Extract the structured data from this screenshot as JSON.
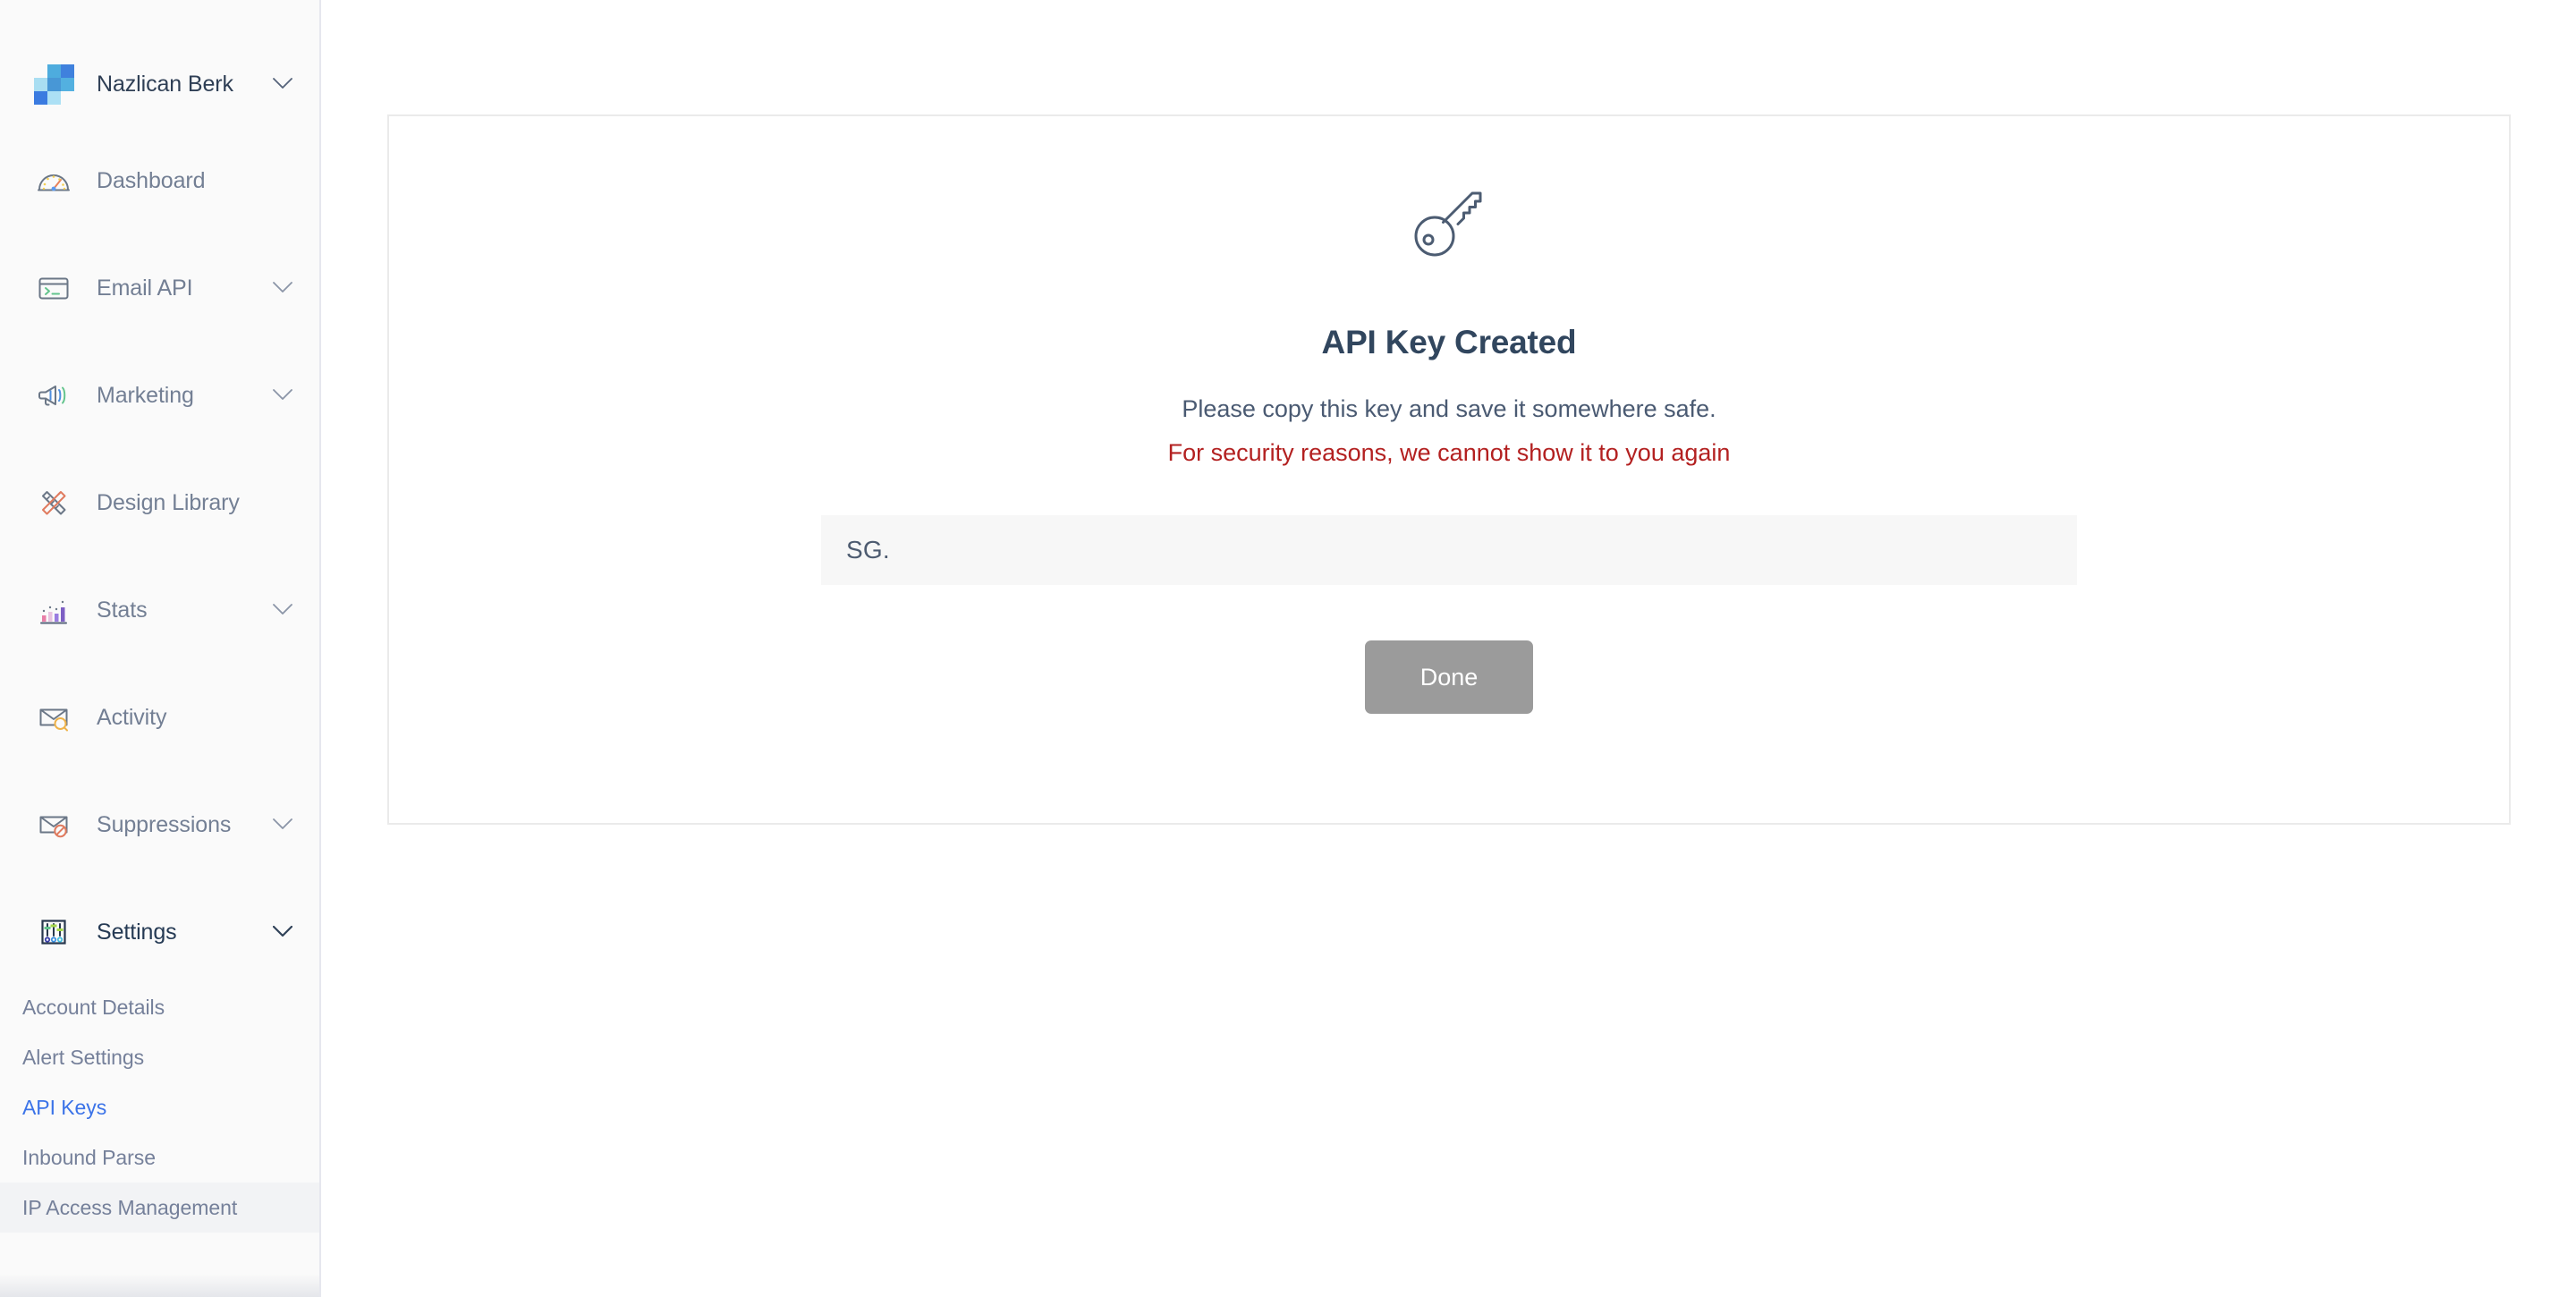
{
  "sidebar": {
    "account": {
      "name": "Nazlican Berk",
      "caret_icon": "chevron-down-icon",
      "logo_icon": "sendgrid-logo-icon",
      "logo_colors": [
        "#a9def2",
        "#4eacde",
        "#3f81dd",
        "#4897d6",
        "#53b0e0",
        "#3a7be0",
        "#ace0f5"
      ]
    },
    "items": [
      {
        "label": "Dashboard",
        "icon": "speedometer-icon",
        "has_caret": false,
        "active": false
      },
      {
        "label": "Email API",
        "icon": "terminal-card-icon",
        "has_caret": true,
        "active": false
      },
      {
        "label": "Marketing",
        "icon": "megaphone-icon",
        "has_caret": true,
        "active": false
      },
      {
        "label": "Design Library",
        "icon": "pencil-ruler-icon",
        "has_caret": false,
        "active": false
      },
      {
        "label": "Stats",
        "icon": "bar-chart-icon",
        "has_caret": true,
        "active": false
      },
      {
        "label": "Activity",
        "icon": "envelope-search-icon",
        "has_caret": false,
        "active": false
      },
      {
        "label": "Suppressions",
        "icon": "envelope-blocked-icon",
        "has_caret": true,
        "active": false
      },
      {
        "label": "Settings",
        "icon": "sliders-icon",
        "has_caret": true,
        "active": true
      }
    ],
    "sub_items": [
      {
        "label": "Account Details",
        "selected": false,
        "hovered": false
      },
      {
        "label": "Alert Settings",
        "selected": false,
        "hovered": false
      },
      {
        "label": "API Keys",
        "selected": true,
        "hovered": false
      },
      {
        "label": "Inbound Parse",
        "selected": false,
        "hovered": false
      },
      {
        "label": "IP Access Management",
        "selected": false,
        "hovered": true
      }
    ]
  },
  "main": {
    "card": {
      "icon": "key-icon",
      "title": "API Key Created",
      "subtitle": "Please copy this key and save it somewhere safe.",
      "warning": "For security reasons, we cannot show it to you again",
      "key_value": "SG.",
      "done_label": "Done"
    }
  },
  "colors": {
    "accent_link": "#3b73e8",
    "warning_red": "#b32020",
    "title_navy": "#31465e",
    "button_gray": "#9b9b9b",
    "sidebar_bg": "#fafafa"
  }
}
